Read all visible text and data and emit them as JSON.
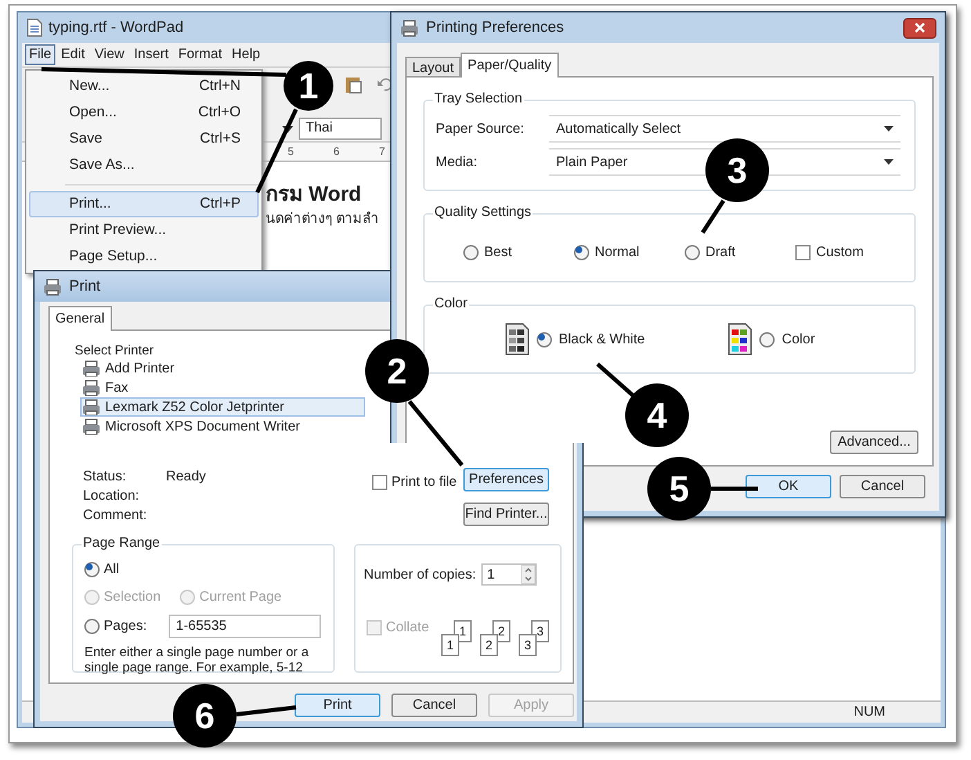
{
  "wordpad": {
    "title": "typing.rtf - WordPad",
    "menu": [
      {
        "label": "File",
        "selected": true
      },
      {
        "label": "Edit",
        "selected": false
      },
      {
        "label": "View",
        "selected": false
      },
      {
        "label": "Insert",
        "selected": false
      },
      {
        "label": "Format",
        "selected": false
      },
      {
        "label": "Help",
        "selected": false
      }
    ],
    "file_menu": [
      {
        "kind": "item",
        "label": "New...",
        "shortcut": "Ctrl+N",
        "selected": false
      },
      {
        "kind": "item",
        "label": "Open...",
        "shortcut": "Ctrl+O",
        "selected": false
      },
      {
        "kind": "item",
        "label": "Save",
        "shortcut": "Ctrl+S",
        "selected": false
      },
      {
        "kind": "item",
        "label": "Save As...",
        "selected": false
      },
      {
        "kind": "separator"
      },
      {
        "kind": "item",
        "label": "Print...",
        "shortcut": "Ctrl+P",
        "selected": true
      },
      {
        "kind": "item",
        "label": "Print Preview...",
        "selected": false
      },
      {
        "kind": "item",
        "label": "Page Setup...",
        "selected": false
      }
    ],
    "script_field": "Thai",
    "ruler_labels": [
      "5",
      "6",
      "7"
    ],
    "document_lines": [
      {
        "text": "กรม Word",
        "kind": "heading"
      },
      {
        "text": "นดค่าต่างๆ ตามลำ",
        "kind": "body"
      }
    ],
    "status": "NUM"
  },
  "printing_preferences": {
    "title": "Printing Preferences",
    "tabs": [
      {
        "label": "Layout",
        "selected": false
      },
      {
        "label": "Paper/Quality",
        "selected": true
      }
    ],
    "tray_selection": {
      "title": "Tray Selection",
      "fields": [
        {
          "label": "Paper Source:",
          "value": "Automatically Select"
        },
        {
          "label": "Media:",
          "value": "Plain Paper"
        }
      ]
    },
    "quality_settings": {
      "title": "Quality Settings",
      "options": [
        {
          "kind": "radio",
          "label": "Best",
          "selected": false
        },
        {
          "kind": "radio",
          "label": "Normal",
          "selected": true
        },
        {
          "kind": "radio",
          "label": "Draft",
          "selected": false
        },
        {
          "kind": "checkbox",
          "label": "Custom",
          "checked": false
        }
      ]
    },
    "color": {
      "title": "Color",
      "options": [
        {
          "kind": "grayscale",
          "label": "Black & White",
          "selected": true
        },
        {
          "kind": "color",
          "label": "Color",
          "selected": false
        }
      ]
    },
    "advanced_button": "Advanced...",
    "buttons": [
      {
        "label": "OK",
        "default": true
      },
      {
        "label": "Cancel",
        "default": false
      }
    ]
  },
  "print": {
    "title": "Print",
    "tabs": [
      {
        "label": "General",
        "selected": true
      }
    ],
    "select_printer": {
      "title": "Select Printer",
      "printers": [
        {
          "label": "Add Printer",
          "selected": false
        },
        {
          "label": "Fax",
          "selected": false
        },
        {
          "label": "Lexmark Z52 Color Jetprinter",
          "selected": true
        },
        {
          "label": "Microsoft XPS Document Writer",
          "selected": false
        }
      ],
      "status_label": "Status:",
      "status": "Ready",
      "location_label": "Location:",
      "comment_label": "Comment:",
      "print_to_file": {
        "label": "Print to file",
        "checked": false
      },
      "preferences_button": "Preferences",
      "find_printer_button": "Find Printer..."
    },
    "page_range": {
      "title": "Page Range",
      "options": [
        {
          "label": "All",
          "selected": true,
          "disabled": false
        },
        {
          "label": "Selection",
          "selected": false,
          "disabled": true
        },
        {
          "label": "Current Page",
          "selected": false,
          "disabled": true
        },
        {
          "label": "Pages:",
          "selected": false,
          "disabled": false
        }
      ],
      "pages_value": "1-65535",
      "hint": "Enter either a single page number or a single page range.  For example, 5-12"
    },
    "copies": {
      "label": "Number of copies:",
      "value": "1",
      "collate": {
        "label": "Collate",
        "checked": false,
        "disabled": true
      },
      "collate_pages": [
        "1",
        "1",
        "2",
        "2",
        "3",
        "3"
      ]
    },
    "buttons": [
      {
        "label": "Print",
        "default": true,
        "disabled": false
      },
      {
        "label": "Cancel",
        "default": false,
        "disabled": false
      },
      {
        "label": "Apply",
        "default": false,
        "disabled": true
      }
    ]
  },
  "callouts": [
    "1",
    "2",
    "3",
    "4",
    "5",
    "6"
  ]
}
